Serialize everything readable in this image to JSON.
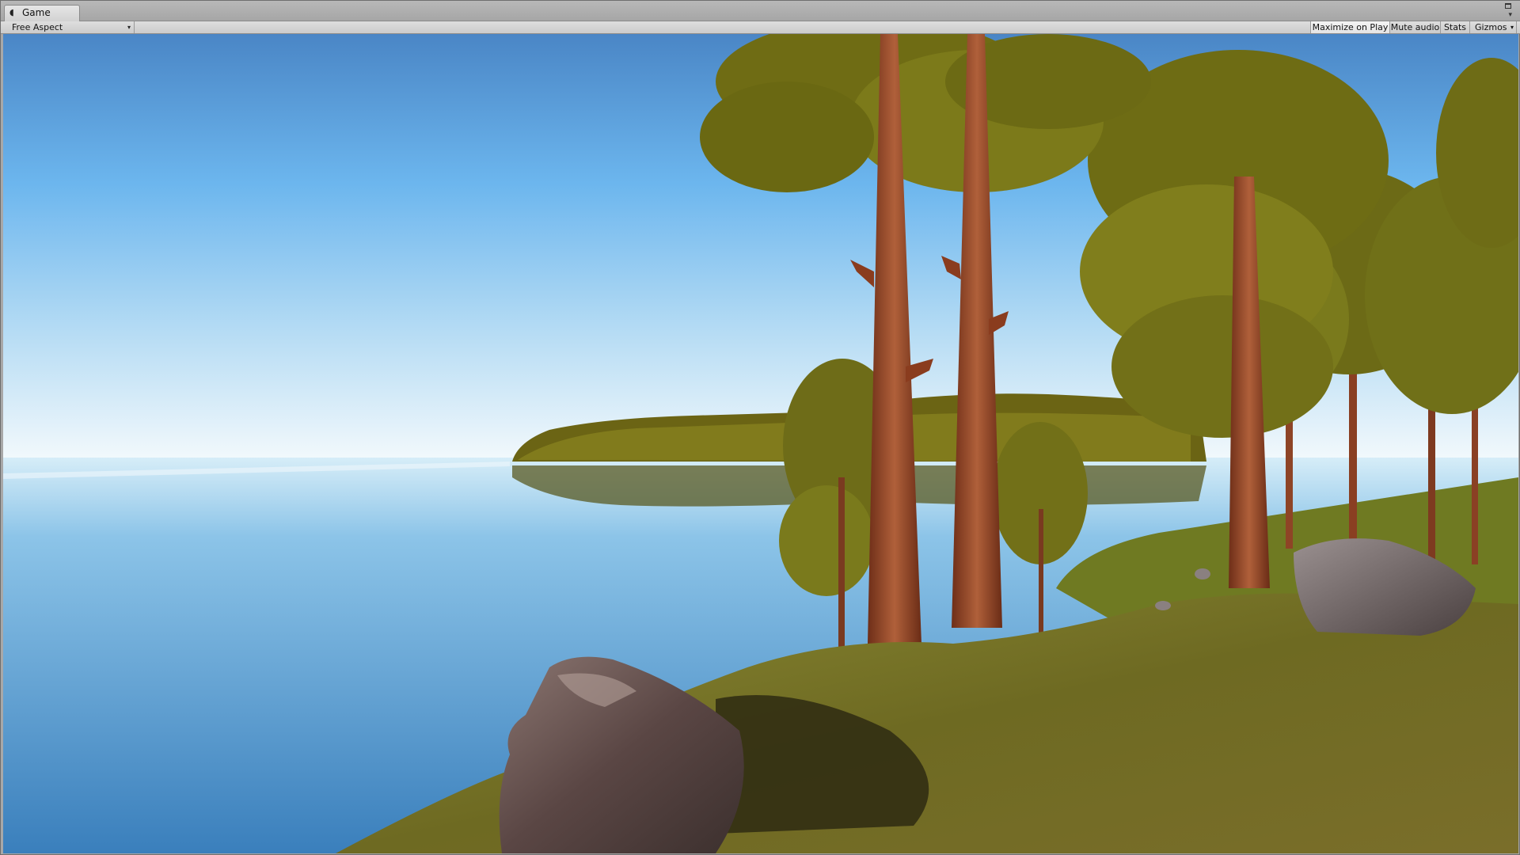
{
  "window": {
    "tab_label": "Game",
    "tab_icon": "unity-logo-icon"
  },
  "toolbar": {
    "aspect_label": "Free Aspect",
    "maximize_label": "Maximize on Play",
    "mute_label": "Mute audio",
    "stats_label": "Stats",
    "gizmos_label": "Gizmos"
  },
  "colors": {
    "sky_top": "#4f8fce",
    "sky_horizon": "#f2f8fc",
    "water_top": "#cfe9f6",
    "water_bottom": "#3d82bf",
    "foliage": "#8a8a1a",
    "trunk": "#9a4a2a",
    "moss": "#7c7a28",
    "rock": "#6e5550"
  }
}
